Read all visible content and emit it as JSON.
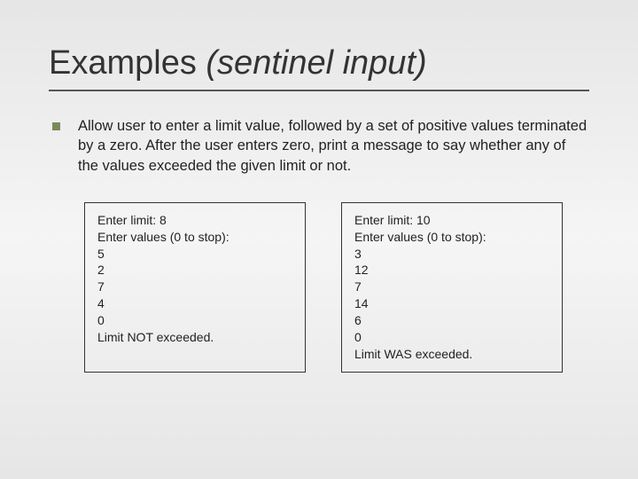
{
  "title_main": "Examples ",
  "title_sub": "(sentinel input)",
  "description": "Allow user to enter a limit value, followed by a set of positive values terminated by a zero. After the user enters zero, print a message to say whether any of the values exceeded the given limit or not.",
  "example1": "Enter limit: 8\nEnter values (0 to stop):\n5\n2\n7\n4\n0\nLimit NOT exceeded.",
  "example2": "Enter limit: 10\nEnter values (0 to stop):\n3\n12\n7\n14\n6\n0\nLimit WAS exceeded."
}
